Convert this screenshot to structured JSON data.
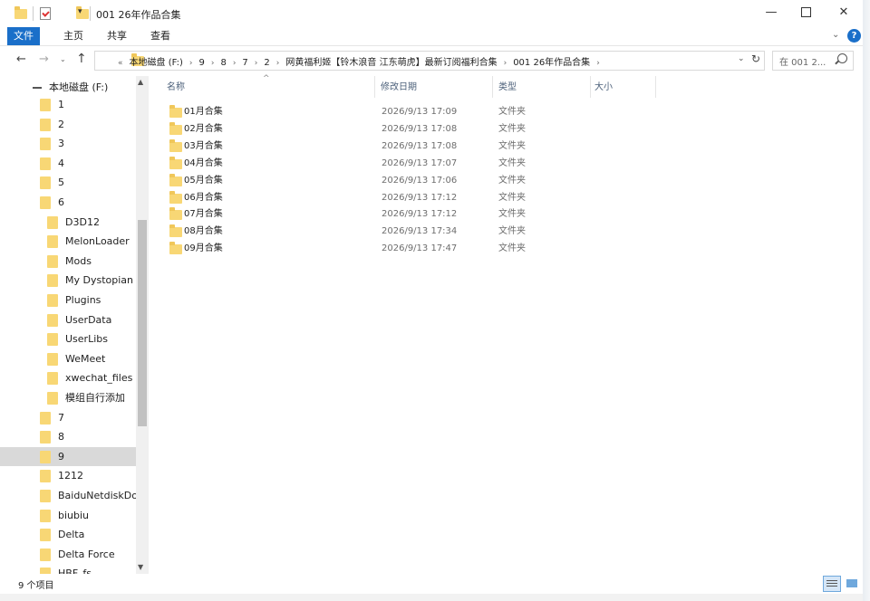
{
  "window": {
    "title": "001 26年作品合集",
    "quick_access_dropdown": "▾",
    "minimize": "—",
    "close": "✕"
  },
  "ribbon": {
    "tabs": [
      "文件",
      "主页",
      "共享",
      "查看"
    ],
    "expand": "⌄",
    "help": "?"
  },
  "nav": {
    "back": "←",
    "forward": "→",
    "recent": "⌄",
    "up": "↑",
    "address_prefix": "«",
    "path": [
      "本地磁盘 (F:)",
      "9",
      "8",
      "7",
      "2",
      "网黄福利姬【铃木浪音 江东萌虎】最新订阅福利合集",
      "001 26年作品合集"
    ],
    "address_dropdown": "⌄",
    "refresh": "↻",
    "search_placeholder": "在 001 2..."
  },
  "sidebar": {
    "drive": "本地磁盘 (F:)",
    "items": [
      {
        "label": "1",
        "indent": 1
      },
      {
        "label": "2",
        "indent": 1
      },
      {
        "label": "3",
        "indent": 1
      },
      {
        "label": "4",
        "indent": 1
      },
      {
        "label": "5",
        "indent": 1
      },
      {
        "label": "6",
        "indent": 1
      },
      {
        "label": "D3D12",
        "indent": 2
      },
      {
        "label": "MelonLoader",
        "indent": 2
      },
      {
        "label": "Mods",
        "indent": 2
      },
      {
        "label": "My Dystopian F",
        "indent": 2
      },
      {
        "label": "Plugins",
        "indent": 2
      },
      {
        "label": "UserData",
        "indent": 2
      },
      {
        "label": "UserLibs",
        "indent": 2
      },
      {
        "label": "WeMeet",
        "indent": 2
      },
      {
        "label": "xwechat_files",
        "indent": 2
      },
      {
        "label": "模组自行添加",
        "indent": 2
      },
      {
        "label": "7",
        "indent": 1
      },
      {
        "label": "8",
        "indent": 1
      },
      {
        "label": "9",
        "indent": 1,
        "selected": true
      },
      {
        "label": "1212",
        "indent": 1
      },
      {
        "label": "BaiduNetdiskDov",
        "indent": 1
      },
      {
        "label": "biubiu",
        "indent": 1
      },
      {
        "label": "Delta",
        "indent": 1
      },
      {
        "label": "Delta Force",
        "indent": 1
      },
      {
        "label": "HBF..fs",
        "indent": 1
      }
    ],
    "scroll_up": "▲",
    "scroll_down": "▼"
  },
  "columns": {
    "name": "名称",
    "date": "修改日期",
    "type": "类型",
    "size": "大小",
    "sort_indicator": "^"
  },
  "files": [
    {
      "name": "01月合集",
      "date": "2026/9/13 17:09",
      "type": "文件夹"
    },
    {
      "name": "02月合集",
      "date": "2026/9/13 17:08",
      "type": "文件夹"
    },
    {
      "name": "03月合集",
      "date": "2026/9/13 17:08",
      "type": "文件夹"
    },
    {
      "name": "04月合集",
      "date": "2026/9/13 17:07",
      "type": "文件夹"
    },
    {
      "name": "05月合集",
      "date": "2026/9/13 17:06",
      "type": "文件夹"
    },
    {
      "name": "06月合集",
      "date": "2026/9/13 17:12",
      "type": "文件夹"
    },
    {
      "name": "07月合集",
      "date": "2026/9/13 17:12",
      "type": "文件夹"
    },
    {
      "name": "08月合集",
      "date": "2026/9/13 17:34",
      "type": "文件夹"
    },
    {
      "name": "09月合集",
      "date": "2026/9/13 17:47",
      "type": "文件夹"
    }
  ],
  "status": {
    "item_count": "9 个项目"
  },
  "colors": {
    "accent": "#1a6fc9",
    "folder": "#f8d775",
    "selection": "#d9d9d9"
  }
}
